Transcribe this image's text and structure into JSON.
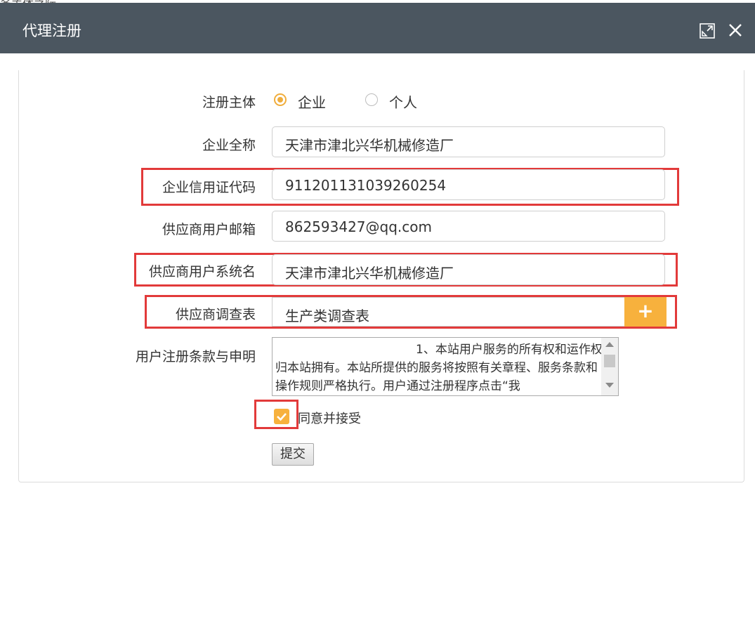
{
  "background": {
    "text": "务主体之际"
  },
  "dialog": {
    "title": "代理注册",
    "maximize_icon": "maximize-icon",
    "close_icon": "close-icon"
  },
  "form": {
    "subject_label": "注册主体",
    "subject_options": [
      "企业",
      "个人"
    ],
    "subject_selected": "企业",
    "company_name_label": "企业全称",
    "company_name_value": "天津市津北兴华机械修造厂",
    "credit_code_label": "企业信用证代码",
    "credit_code_value": "911201131039260254",
    "email_label": "供应商用户邮箱",
    "email_value": "862593427@qq.com",
    "system_name_label": "供应商用户系统名",
    "system_name_value": "天津市津北兴华机械修造厂",
    "survey_label": "供应商调查表",
    "survey_value": "生产类调查表",
    "survey_add_icon": "plus-icon",
    "terms_label": "用户注册条款与申明",
    "terms_text": "1、本站用户服务的所有权和运作权归本站拥有。本站所提供的服务将按照有关章程、服务条款和操作规则严格执行。用户通过注册程序点击“我",
    "agree_checked": true,
    "agree_label": "同意并接受",
    "submit_label": "提交"
  },
  "colors": {
    "titlebar": "#4b5660",
    "accent": "#f7b13d",
    "highlight": "#e23a3a"
  }
}
